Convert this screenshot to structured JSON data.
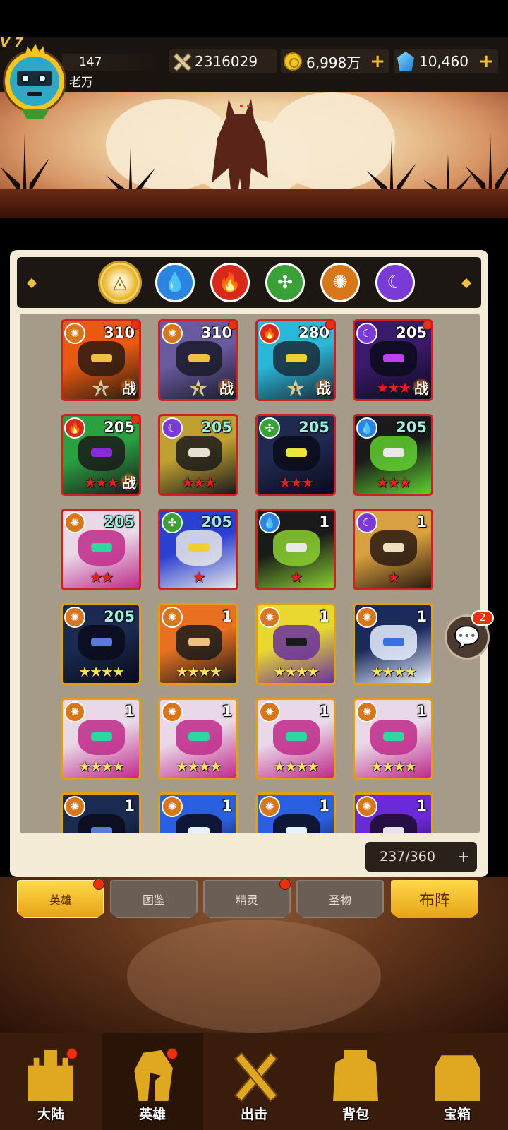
{
  "player": {
    "vip": "V 7",
    "level": "147",
    "name": "老万"
  },
  "resources": {
    "power": "2316029",
    "gold": "6,998万",
    "gems": "10,460"
  },
  "filters": [
    {
      "name": "all",
      "icon": "triangle-icon"
    },
    {
      "name": "water",
      "icon": "water-drop-icon"
    },
    {
      "name": "fire",
      "icon": "flame-icon"
    },
    {
      "name": "wind",
      "icon": "leaf-swirl-icon"
    },
    {
      "name": "sun",
      "icon": "sun-icon"
    },
    {
      "name": "moon",
      "icon": "moon-icon"
    }
  ],
  "heroes": [
    {
      "level": "310",
      "element": "sun",
      "stars": "2",
      "frame": "red",
      "in_battle": "战",
      "dot": true
    },
    {
      "level": "310",
      "element": "sun",
      "stars": "2",
      "frame": "red",
      "in_battle": "战",
      "dot": true
    },
    {
      "level": "280",
      "element": "fire",
      "stars": "1",
      "frame": "red",
      "in_battle": "战",
      "dot": true
    },
    {
      "level": "205",
      "element": "moon",
      "stars": "★★★",
      "frame": "red",
      "in_battle": "战",
      "dot": true
    },
    {
      "level": "205",
      "element": "fire",
      "stars": "★★★",
      "frame": "red",
      "in_battle": "战",
      "dot": true
    },
    {
      "level": "205",
      "element": "moon",
      "stars": "★★★",
      "frame": "red",
      "in_battle": "",
      "dot": false
    },
    {
      "level": "205",
      "element": "leaf",
      "stars": "★★★",
      "frame": "red",
      "in_battle": "",
      "dot": false
    },
    {
      "level": "205",
      "element": "water",
      "stars": "★★★",
      "frame": "red",
      "in_battle": "",
      "dot": false
    },
    {
      "level": "205",
      "element": "sun",
      "stars": "★★",
      "frame": "red",
      "in_battle": "",
      "dot": false
    },
    {
      "level": "205",
      "element": "leaf",
      "stars": "★",
      "frame": "red",
      "in_battle": "",
      "dot": false
    },
    {
      "level": "1",
      "element": "water",
      "stars": "★",
      "frame": "red",
      "in_battle": "",
      "dot": false
    },
    {
      "level": "1",
      "element": "moon",
      "stars": "★",
      "frame": "red",
      "in_battle": "",
      "dot": false
    },
    {
      "level": "205",
      "element": "sun",
      "stars": "★★★★",
      "frame": "gold",
      "in_battle": "",
      "dot": false
    },
    {
      "level": "1",
      "element": "sun",
      "stars": "★★★★",
      "frame": "gold",
      "in_battle": "",
      "dot": false
    },
    {
      "level": "1",
      "element": "sun",
      "stars": "★★★★",
      "frame": "gold",
      "in_battle": "",
      "dot": false
    },
    {
      "level": "1",
      "element": "sun",
      "stars": "★★★★",
      "frame": "gold",
      "in_battle": "",
      "dot": false
    },
    {
      "level": "1",
      "element": "sun",
      "stars": "★★★★",
      "frame": "gold",
      "in_battle": "",
      "dot": false
    },
    {
      "level": "1",
      "element": "sun",
      "stars": "★★★★",
      "frame": "gold",
      "in_battle": "",
      "dot": false
    },
    {
      "level": "1",
      "element": "sun",
      "stars": "★★★★",
      "frame": "gold",
      "in_battle": "",
      "dot": false
    },
    {
      "level": "1",
      "element": "sun",
      "stars": "★★★★",
      "frame": "gold",
      "in_battle": "",
      "dot": false
    },
    {
      "level": "1",
      "element": "sun",
      "stars": "",
      "frame": "gold",
      "in_battle": "",
      "dot": false
    },
    {
      "level": "1",
      "element": "sun",
      "stars": "",
      "frame": "gold",
      "in_battle": "",
      "dot": false
    },
    {
      "level": "1",
      "element": "sun",
      "stars": "",
      "frame": "gold",
      "in_battle": "",
      "dot": false
    },
    {
      "level": "1",
      "element": "sun",
      "stars": "",
      "frame": "gold",
      "in_battle": "",
      "dot": false
    }
  ],
  "hero_count": "237/360",
  "chat_badge": "2",
  "subtabs": {
    "heroes": "英雄",
    "codex": "图鉴",
    "spirits": "精灵",
    "relics": "圣物",
    "formation": "布阵"
  },
  "nav": {
    "continent": "大陆",
    "heroes": "英雄",
    "battle": "出击",
    "backpack": "背包",
    "treasure": "宝箱"
  },
  "colors": {
    "accent_gold": "#f4c420",
    "frame_red": "#cf2020",
    "frame_gold": "#e0a010",
    "notify_red": "#e8320e"
  }
}
